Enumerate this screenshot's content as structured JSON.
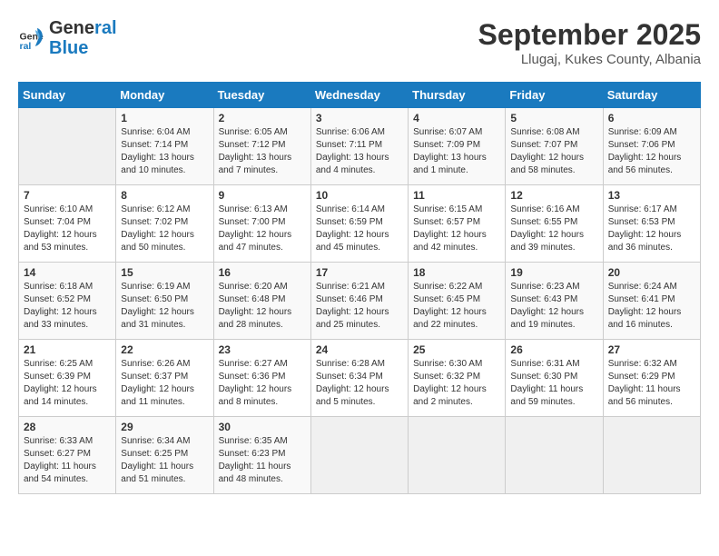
{
  "header": {
    "logo_line1": "General",
    "logo_line2": "Blue",
    "month": "September 2025",
    "location": "Llugaj, Kukes County, Albania"
  },
  "weekdays": [
    "Sunday",
    "Monday",
    "Tuesday",
    "Wednesday",
    "Thursday",
    "Friday",
    "Saturday"
  ],
  "weeks": [
    [
      {
        "day": "",
        "sunrise": "",
        "sunset": "",
        "daylight": ""
      },
      {
        "day": "1",
        "sunrise": "Sunrise: 6:04 AM",
        "sunset": "Sunset: 7:14 PM",
        "daylight": "Daylight: 13 hours and 10 minutes."
      },
      {
        "day": "2",
        "sunrise": "Sunrise: 6:05 AM",
        "sunset": "Sunset: 7:12 PM",
        "daylight": "Daylight: 13 hours and 7 minutes."
      },
      {
        "day": "3",
        "sunrise": "Sunrise: 6:06 AM",
        "sunset": "Sunset: 7:11 PM",
        "daylight": "Daylight: 13 hours and 4 minutes."
      },
      {
        "day": "4",
        "sunrise": "Sunrise: 6:07 AM",
        "sunset": "Sunset: 7:09 PM",
        "daylight": "Daylight: 13 hours and 1 minute."
      },
      {
        "day": "5",
        "sunrise": "Sunrise: 6:08 AM",
        "sunset": "Sunset: 7:07 PM",
        "daylight": "Daylight: 12 hours and 58 minutes."
      },
      {
        "day": "6",
        "sunrise": "Sunrise: 6:09 AM",
        "sunset": "Sunset: 7:06 PM",
        "daylight": "Daylight: 12 hours and 56 minutes."
      }
    ],
    [
      {
        "day": "7",
        "sunrise": "Sunrise: 6:10 AM",
        "sunset": "Sunset: 7:04 PM",
        "daylight": "Daylight: 12 hours and 53 minutes."
      },
      {
        "day": "8",
        "sunrise": "Sunrise: 6:12 AM",
        "sunset": "Sunset: 7:02 PM",
        "daylight": "Daylight: 12 hours and 50 minutes."
      },
      {
        "day": "9",
        "sunrise": "Sunrise: 6:13 AM",
        "sunset": "Sunset: 7:00 PM",
        "daylight": "Daylight: 12 hours and 47 minutes."
      },
      {
        "day": "10",
        "sunrise": "Sunrise: 6:14 AM",
        "sunset": "Sunset: 6:59 PM",
        "daylight": "Daylight: 12 hours and 45 minutes."
      },
      {
        "day": "11",
        "sunrise": "Sunrise: 6:15 AM",
        "sunset": "Sunset: 6:57 PM",
        "daylight": "Daylight: 12 hours and 42 minutes."
      },
      {
        "day": "12",
        "sunrise": "Sunrise: 6:16 AM",
        "sunset": "Sunset: 6:55 PM",
        "daylight": "Daylight: 12 hours and 39 minutes."
      },
      {
        "day": "13",
        "sunrise": "Sunrise: 6:17 AM",
        "sunset": "Sunset: 6:53 PM",
        "daylight": "Daylight: 12 hours and 36 minutes."
      }
    ],
    [
      {
        "day": "14",
        "sunrise": "Sunrise: 6:18 AM",
        "sunset": "Sunset: 6:52 PM",
        "daylight": "Daylight: 12 hours and 33 minutes."
      },
      {
        "day": "15",
        "sunrise": "Sunrise: 6:19 AM",
        "sunset": "Sunset: 6:50 PM",
        "daylight": "Daylight: 12 hours and 31 minutes."
      },
      {
        "day": "16",
        "sunrise": "Sunrise: 6:20 AM",
        "sunset": "Sunset: 6:48 PM",
        "daylight": "Daylight: 12 hours and 28 minutes."
      },
      {
        "day": "17",
        "sunrise": "Sunrise: 6:21 AM",
        "sunset": "Sunset: 6:46 PM",
        "daylight": "Daylight: 12 hours and 25 minutes."
      },
      {
        "day": "18",
        "sunrise": "Sunrise: 6:22 AM",
        "sunset": "Sunset: 6:45 PM",
        "daylight": "Daylight: 12 hours and 22 minutes."
      },
      {
        "day": "19",
        "sunrise": "Sunrise: 6:23 AM",
        "sunset": "Sunset: 6:43 PM",
        "daylight": "Daylight: 12 hours and 19 minutes."
      },
      {
        "day": "20",
        "sunrise": "Sunrise: 6:24 AM",
        "sunset": "Sunset: 6:41 PM",
        "daylight": "Daylight: 12 hours and 16 minutes."
      }
    ],
    [
      {
        "day": "21",
        "sunrise": "Sunrise: 6:25 AM",
        "sunset": "Sunset: 6:39 PM",
        "daylight": "Daylight: 12 hours and 14 minutes."
      },
      {
        "day": "22",
        "sunrise": "Sunrise: 6:26 AM",
        "sunset": "Sunset: 6:37 PM",
        "daylight": "Daylight: 12 hours and 11 minutes."
      },
      {
        "day": "23",
        "sunrise": "Sunrise: 6:27 AM",
        "sunset": "Sunset: 6:36 PM",
        "daylight": "Daylight: 12 hours and 8 minutes."
      },
      {
        "day": "24",
        "sunrise": "Sunrise: 6:28 AM",
        "sunset": "Sunset: 6:34 PM",
        "daylight": "Daylight: 12 hours and 5 minutes."
      },
      {
        "day": "25",
        "sunrise": "Sunrise: 6:30 AM",
        "sunset": "Sunset: 6:32 PM",
        "daylight": "Daylight: 12 hours and 2 minutes."
      },
      {
        "day": "26",
        "sunrise": "Sunrise: 6:31 AM",
        "sunset": "Sunset: 6:30 PM",
        "daylight": "Daylight: 11 hours and 59 minutes."
      },
      {
        "day": "27",
        "sunrise": "Sunrise: 6:32 AM",
        "sunset": "Sunset: 6:29 PM",
        "daylight": "Daylight: 11 hours and 56 minutes."
      }
    ],
    [
      {
        "day": "28",
        "sunrise": "Sunrise: 6:33 AM",
        "sunset": "Sunset: 6:27 PM",
        "daylight": "Daylight: 11 hours and 54 minutes."
      },
      {
        "day": "29",
        "sunrise": "Sunrise: 6:34 AM",
        "sunset": "Sunset: 6:25 PM",
        "daylight": "Daylight: 11 hours and 51 minutes."
      },
      {
        "day": "30",
        "sunrise": "Sunrise: 6:35 AM",
        "sunset": "Sunset: 6:23 PM",
        "daylight": "Daylight: 11 hours and 48 minutes."
      },
      {
        "day": "",
        "sunrise": "",
        "sunset": "",
        "daylight": ""
      },
      {
        "day": "",
        "sunrise": "",
        "sunset": "",
        "daylight": ""
      },
      {
        "day": "",
        "sunrise": "",
        "sunset": "",
        "daylight": ""
      },
      {
        "day": "",
        "sunrise": "",
        "sunset": "",
        "daylight": ""
      }
    ]
  ]
}
